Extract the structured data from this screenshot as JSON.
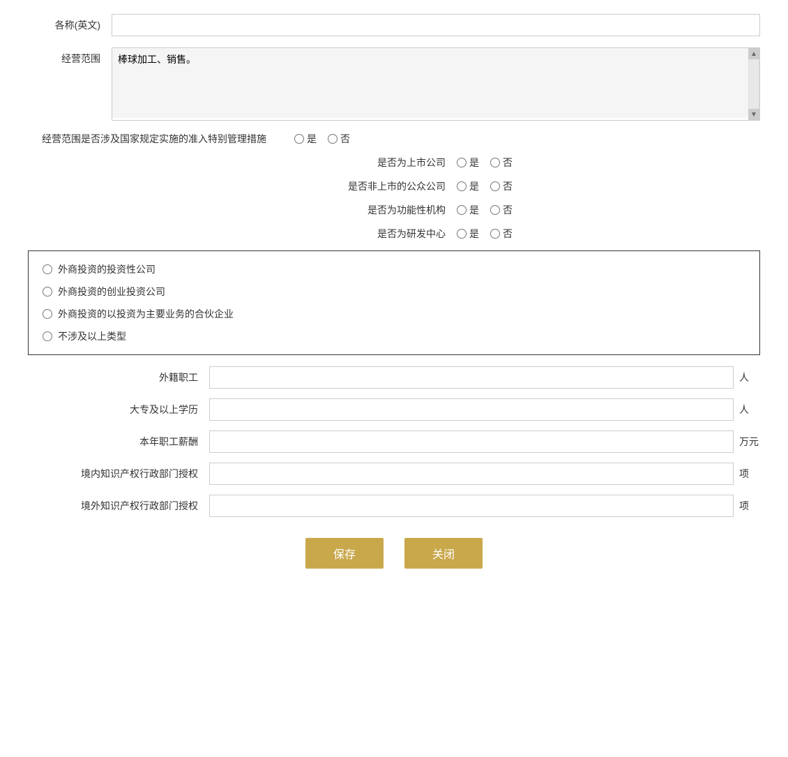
{
  "form": {
    "name_en_label": "各称(英文)",
    "name_en_value": "",
    "business_scope_label": "经营范围",
    "business_scope_value": "棒球加工、销售。",
    "special_mgmt_label": "经营范围是否涉及国家规定实施的准入特别管理措施",
    "special_mgmt_yes": "是",
    "special_mgmt_no": "否",
    "listed_company_label": "是否为上市公司",
    "listed_yes": "是",
    "listed_no": "否",
    "non_listed_public_label": "是否非上市的公众公司",
    "non_listed_public_yes": "是",
    "non_listed_public_no": "否",
    "functional_org_label": "是否为功能性机构",
    "functional_yes": "是",
    "functional_no": "否",
    "rd_center_label": "是否为研发中心",
    "rd_yes": "是",
    "rd_no": "否",
    "investment_options": [
      "外商投资的投资性公司",
      "外商投资的创业投资公司",
      "外商投资的以投资为主要业务的合伙企业",
      "不涉及以上类型"
    ],
    "foreign_workers_label": "外籍职工",
    "foreign_workers_unit": "人",
    "college_degree_label": "大专及以上学历",
    "college_degree_unit": "人",
    "annual_salary_label": "本年职工薪酬",
    "annual_salary_unit": "万元",
    "domestic_ip_label": "境内知识产权行政部门授权",
    "domestic_ip_unit": "项",
    "foreign_ip_label": "境外知识产权行政部门授权",
    "foreign_ip_unit": "项",
    "save_label": "保存",
    "close_label": "关闭"
  }
}
